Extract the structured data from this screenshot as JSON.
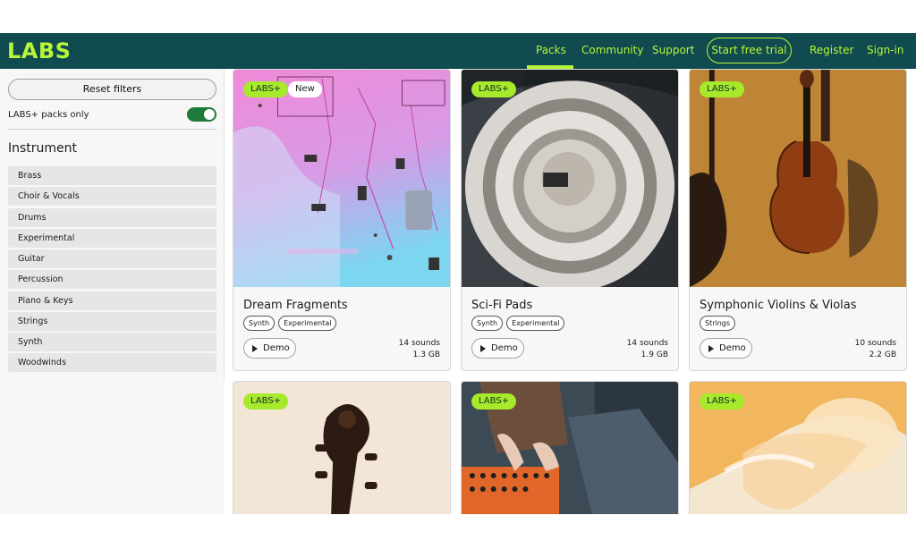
{
  "header": {
    "logo": "LABS",
    "nav": {
      "packs": "Packs",
      "community": "Community",
      "support": "Support",
      "trial": "Start free trial",
      "register": "Register",
      "signin": "Sign-in"
    },
    "accent_color": "#b7f63a",
    "background_color": "#0f4b4f"
  },
  "sidebar": {
    "reset_label": "Reset filters",
    "labs_only_label": "LABS+ packs only",
    "labs_only_toggle": true,
    "instrument_heading": "Instrument",
    "instruments": [
      "Brass",
      "Choir & Vocals",
      "Drums",
      "Experimental",
      "Guitar",
      "Percussion",
      "Piano & Keys",
      "Strings",
      "Synth",
      "Woodwinds"
    ]
  },
  "cards": [
    {
      "badge": "LABS+",
      "new_badge": "New",
      "title": "Dream Fragments",
      "tags": [
        "Synth",
        "Experimental"
      ],
      "demo": "Demo",
      "sounds": "14 sounds",
      "size": "1.3 GB",
      "image": "circuit-board-image"
    },
    {
      "badge": "LABS+",
      "title": "Sci-Fi Pads",
      "tags": [
        "Synth",
        "Experimental"
      ],
      "demo": "Demo",
      "sounds": "14 sounds",
      "size": "1.9 GB",
      "image": "speaker-spiral-image"
    },
    {
      "badge": "LABS+",
      "title": "Symphonic Violins & Violas",
      "tags": [
        "Strings"
      ],
      "demo": "Demo",
      "sounds": "10 sounds",
      "size": "2.2 GB",
      "image": "violin-image"
    },
    {
      "badge": "LABS+",
      "image": "cello-scroll-image"
    },
    {
      "badge": "LABS+",
      "image": "synth-hands-image"
    },
    {
      "badge": "LABS+",
      "image": "brass-horn-image"
    }
  ]
}
